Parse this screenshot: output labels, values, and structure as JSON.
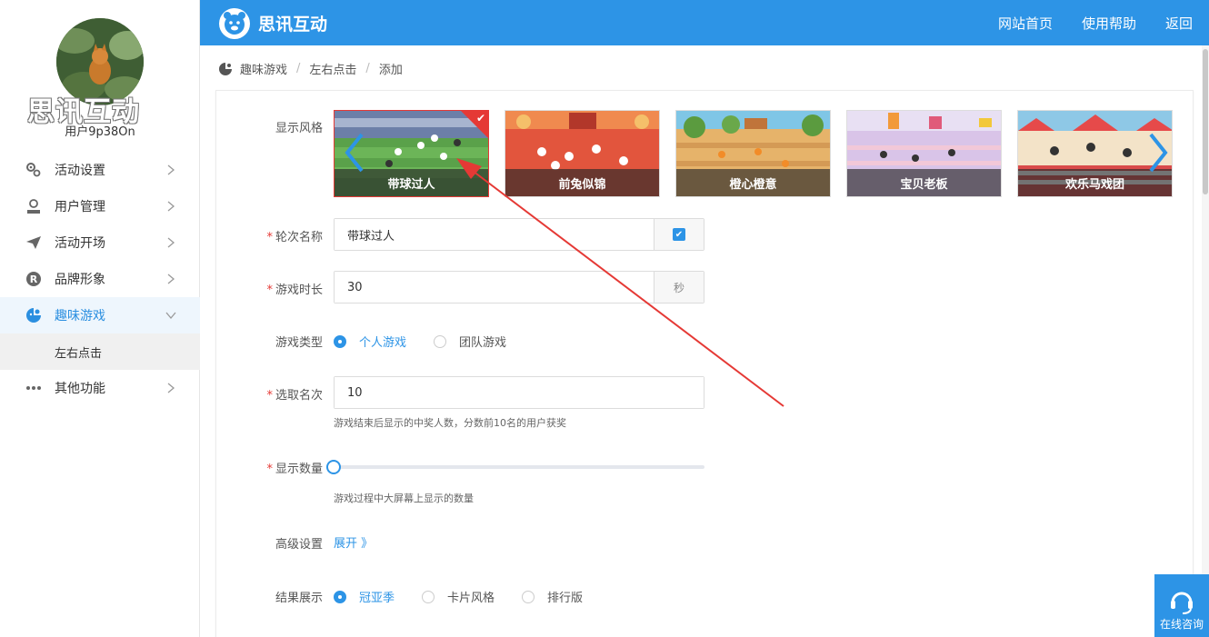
{
  "brand": {
    "name": "思讯互动",
    "logo_overlay_text": "思讯互动"
  },
  "user": {
    "name": "用户9p38On"
  },
  "sidebar": {
    "items": [
      {
        "label": "活动设置",
        "icon": "gears-icon"
      },
      {
        "label": "用户管理",
        "icon": "user-icon"
      },
      {
        "label": "活动开场",
        "icon": "paper-plane-icon"
      },
      {
        "label": "品牌形象",
        "icon": "registered-icon"
      },
      {
        "label": "趣味游戏",
        "icon": "game-icon",
        "active": true
      },
      {
        "label": "其他功能",
        "icon": "more-dots-icon"
      }
    ],
    "submenu": {
      "label": "左右点击"
    }
  },
  "topbar": {
    "links": [
      "网站首页",
      "使用帮助",
      "返回"
    ]
  },
  "breadcrumb": [
    "趣味游戏",
    "左右点击",
    "添加"
  ],
  "form": {
    "style_label": "显示风格",
    "styles": [
      {
        "label": "带球过人",
        "selected": true
      },
      {
        "label": "前兔似锦",
        "selected": false
      },
      {
        "label": "橙心橙意",
        "selected": false
      },
      {
        "label": "宝贝老板",
        "selected": false
      },
      {
        "label": "欢乐马戏团",
        "selected": false
      }
    ],
    "round_name": {
      "label": "轮次名称",
      "value": "带球过人"
    },
    "duration": {
      "label": "游戏时长",
      "value": "30",
      "unit": "秒"
    },
    "game_type": {
      "label": "游戏类型",
      "options": [
        "个人游戏",
        "团队游戏"
      ],
      "selected": "个人游戏"
    },
    "winners": {
      "label": "选取名次",
      "value": "10",
      "hint": "游戏结束后显示的中奖人数，分数前10名的用户获奖"
    },
    "display_count": {
      "label": "显示数量",
      "value": 0,
      "hint": "游戏过程中大屏幕上显示的数量"
    },
    "advanced": {
      "label": "高级设置",
      "link": "展开 》"
    },
    "result": {
      "label": "结果展示",
      "options": [
        "冠亚季",
        "卡片风格",
        "排行版"
      ],
      "selected": "冠亚季"
    }
  },
  "consult": {
    "label": "在线咨询"
  },
  "colors": {
    "primary": "#2d94e6",
    "required": "#e53935",
    "annotation": "#e53935"
  }
}
